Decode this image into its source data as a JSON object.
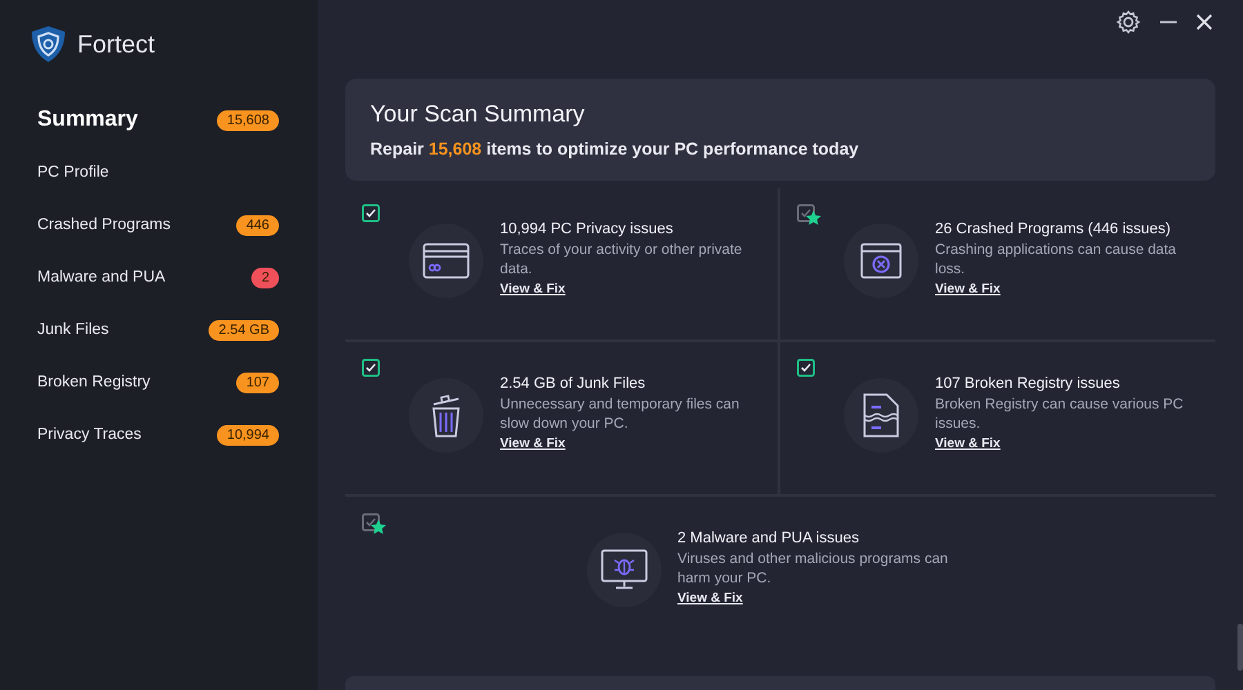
{
  "app": {
    "name": "Fortect"
  },
  "sidebar": {
    "items": [
      {
        "label": "Summary",
        "badge": "15,608",
        "color": "#f7931e",
        "selected": true
      },
      {
        "label": "PC Profile",
        "selected": false
      },
      {
        "label": "Crashed Programs",
        "badge": "446",
        "color": "#f7931e",
        "selected": false
      },
      {
        "label": "Malware and PUA",
        "badge": "2",
        "color": "#f0505a",
        "selected": false
      },
      {
        "label": "Junk Files",
        "badge": "2.54 GB",
        "color": "#f7931e",
        "selected": false
      },
      {
        "label": "Broken Registry",
        "badge": "107",
        "color": "#f7931e",
        "selected": false
      },
      {
        "label": "Privacy Traces",
        "badge": "10,994",
        "color": "#f7931e",
        "selected": false
      }
    ]
  },
  "summary": {
    "title": "Your Scan Summary",
    "subtitle": "Repair **15,608** items to optimize your PC performance today"
  },
  "issues": [
    {
      "title": "10,994 PC Privacy issues",
      "description": "Traces of your activity or other private data.",
      "link": "View & Fix",
      "checked": true,
      "starred": false
    },
    {
      "title": "26 Crashed Programs (446 issues)",
      "description": "Crashing applications can cause data loss.",
      "link": "View & Fix",
      "checked": false,
      "starred": true
    },
    {
      "title": "2.54 GB of Junk Files",
      "description": "Unnecessary and temporary files can slow down your PC.",
      "link": "View & Fix",
      "checked": true,
      "starred": false
    },
    {
      "title": "107 Broken Registry issues",
      "description": "Broken Registry can cause various PC issues.",
      "link": "View & Fix",
      "checked": true,
      "starred": false
    },
    {
      "title": "2 Malware and PUA issues",
      "description": "Viruses and other malicious programs can harm your PC.",
      "link": "View & Fix",
      "checked": false,
      "starred": true
    }
  ]
}
